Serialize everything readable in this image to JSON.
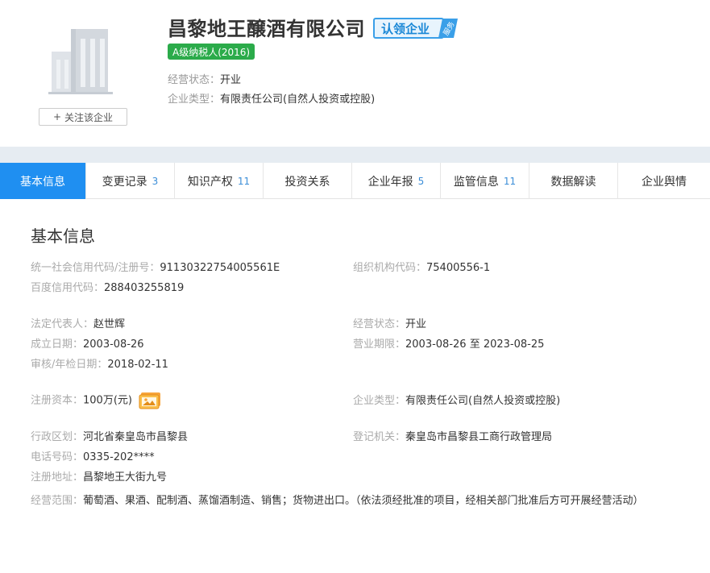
{
  "header": {
    "company_name": "昌黎地王醸酒有限公司",
    "claim_label": "认领企业",
    "claim_tag": "服务",
    "tax_rating": "A级纳税人(2016)",
    "follow_label": "关注该企业",
    "follow_plus": "+",
    "status_label": "经营状态：",
    "status_value": "开业",
    "type_label": "企业类型：",
    "type_value": "有限责任公司(自然人投资或控股)"
  },
  "tabs": [
    {
      "label": "基本信息",
      "count": ""
    },
    {
      "label": "变更记录",
      "count": "3"
    },
    {
      "label": "知识产权",
      "count": "11"
    },
    {
      "label": "投资关系",
      "count": ""
    },
    {
      "label": "企业年报",
      "count": "5"
    },
    {
      "label": "监管信息",
      "count": "11"
    },
    {
      "label": "数据解读",
      "count": ""
    },
    {
      "label": "企业舆情",
      "count": ""
    }
  ],
  "main": {
    "section_title": "基本信息",
    "credit_code_label": "统一社会信用代码/注册号：",
    "credit_code_value": "91130322754005561E",
    "org_code_label": "组织机构代码：",
    "org_code_value": "75400556-1",
    "baidu_code_label": "百度信用代码：",
    "baidu_code_value": "288403255819",
    "legal_rep_label": "法定代表人：",
    "legal_rep_value": "赵世辉",
    "status_label": "经营状态：",
    "status_value": "开业",
    "founded_label": "成立日期：",
    "founded_value": "2003-08-26",
    "term_label": "营业期限：",
    "term_value": "2003-08-26 至 2023-08-25",
    "audit_label": "审核/年检日期：",
    "audit_value": "2018-02-11",
    "capital_label": "注册资本：",
    "capital_value": "100万(元)",
    "type_label": "企业类型：",
    "type_value": "有限责任公司(自然人投资或控股)",
    "district_label": "行政区划：",
    "district_value": "河北省秦皇岛市昌黎县",
    "authority_label": "登记机关：",
    "authority_value": "秦皇岛市昌黎县工商行政管理局",
    "phone_label": "电话号码：",
    "phone_value": "0335-202****",
    "address_label": "注册地址：",
    "address_value": "昌黎地王大街九号",
    "scope_label": "经营范围：",
    "scope_value": "葡萄酒、果酒、配制酒、蒸馏酒制造、销售；货物进出口。（依法须经批准的项目，经相关部门批准后方可开展经营活动）"
  },
  "colors": {
    "accent": "#1f8ff1",
    "tax_badge": "#2bab4a",
    "gray_band": "#e6ecf2"
  }
}
